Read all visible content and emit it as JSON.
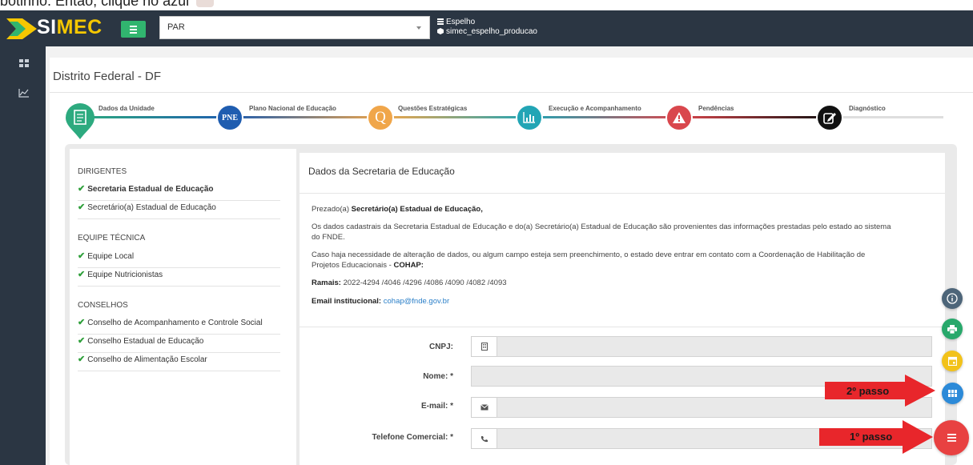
{
  "caption": {
    "text": "botinho. Então, clique no azul"
  },
  "header": {
    "app_name_prefix": "SI",
    "app_name_suffix": "MEC",
    "module_select": {
      "value": "PAR"
    },
    "environment": {
      "line1": "Espelho",
      "line2": "simec_espelho_producao"
    }
  },
  "sidebar": {
    "items": [
      {
        "icon": "grid-icon"
      },
      {
        "icon": "chart-line-icon"
      }
    ]
  },
  "page": {
    "title": "Distrito Federal - DF"
  },
  "wizard": {
    "steps": [
      {
        "label": "Dados da Unidade",
        "icon": "document-icon",
        "color": "#2daa7f"
      },
      {
        "label": "Plano Nacional de Educação",
        "icon_text": "PNE",
        "color": "#1f5db0"
      },
      {
        "label": "Questões Estratégicas",
        "icon_text": "Q",
        "color": "#f0a64a"
      },
      {
        "label": "Execução e Acompanhamento",
        "icon": "bar-chart-icon",
        "color": "#22a5b5"
      },
      {
        "label": "Pendências",
        "icon": "warning-icon",
        "color": "#d9474d"
      },
      {
        "label": "Diagnóstico",
        "icon": "edit-icon",
        "color": "#111111"
      }
    ]
  },
  "left_nav": {
    "groups": [
      {
        "title": "DIRIGENTES",
        "items": [
          {
            "label": "Secretaria Estadual de Educação",
            "active": true
          },
          {
            "label": "Secretário(a) Estadual de Educação",
            "active": false
          }
        ]
      },
      {
        "title": "EQUIPE TÉCNICA",
        "items": [
          {
            "label": "Equipe Local"
          },
          {
            "label": "Equipe Nutricionistas"
          }
        ]
      },
      {
        "title": "CONSELHOS",
        "items": [
          {
            "label": "Conselho de Acompanhamento e Controle Social"
          },
          {
            "label": "Conselho Estadual de Educação"
          },
          {
            "label": "Conselho de Alimentação Escolar"
          }
        ]
      }
    ]
  },
  "form": {
    "title": "Dados da Secretaria de Educação",
    "greeting_prefix": "Prezado(a) ",
    "greeting_bold": "Secretário(a) Estadual de Educação,",
    "para1_line1": "Os dados cadastrais da Secretaria Estadual de Educação e do(a) Secretário(a) Estadual de Educação são provenientes das informações prestadas pelo estado ao sistema",
    "para1_line2": "do FNDE.",
    "para2_line1": "Caso haja necessidade de alteração de dados, ou algum campo esteja sem preenchimento, o estado deve entrar em contato com a Coordenação de Habilitação de",
    "para2_line2_prefix": "Projetos Educacionais - ",
    "para2_line2_bold": "COHAP:",
    "ramais_label": "Ramais:",
    "ramais_value": " 2022-4294 /4046 /4296 /4086 /4090 /4082 /4093",
    "email_label": "Email institucional:",
    "email_value": "cohap@fnde.gov.br",
    "fields": {
      "cnpj_label": "CNPJ:",
      "nome_label": "Nome: *",
      "email_label": "E-mail: *",
      "telefone_label": "Telefone Comercial: *"
    }
  },
  "fabs": [
    {
      "name": "info",
      "icon": "info-icon",
      "color": "#4d6579"
    },
    {
      "name": "print",
      "icon": "print-icon",
      "color": "#28a86b"
    },
    {
      "name": "calendar",
      "icon": "calendar-icon",
      "color": "#f2c21a"
    },
    {
      "name": "apps",
      "icon": "grid-icon",
      "color": "#2c8ad8"
    },
    {
      "name": "menu",
      "icon": "menu-icon",
      "color": "#e84141"
    }
  ],
  "annotations": {
    "step2": "2º passo",
    "step1": "1º passo",
    "arrow_color": "#e8262b"
  }
}
